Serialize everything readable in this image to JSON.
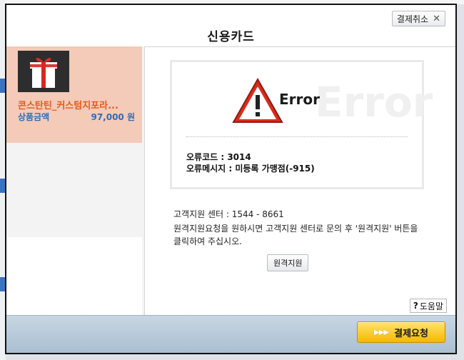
{
  "dialog": {
    "title": "신용카드",
    "cancel_label": "결제취소"
  },
  "product": {
    "name": "콘스탄틴_커스텀지포라...",
    "price_label": "상품금액",
    "price_value": "97,000 원"
  },
  "error": {
    "title": "Error",
    "code_line": "오류코드 : 3014",
    "message_line": "오류메시지 : 미등록 가맹점(-915)"
  },
  "support": {
    "center_line": "고객지원 센터 : 1544 - 8661",
    "instruction_line1": "원격지원요청을 원하시면 고객지원 센터로 문의 후 '원격지원' 버튼을",
    "instruction_line2": "클릭하여 주십시오.",
    "remote_button_label": "원격지원"
  },
  "help": {
    "label": "도움말"
  },
  "footer": {
    "submit_label": "결제요청"
  },
  "colors": {
    "product_bg": "#f4cab8",
    "product_name": "#e05c1d",
    "price": "#2f6db4",
    "submit": "#f6b800",
    "warning_red": "#d92b1b"
  },
  "icons": [
    "close-x-icon",
    "gift-icon",
    "warning-triangle-icon",
    "help-question-icon",
    "triple-arrow-icon"
  ]
}
